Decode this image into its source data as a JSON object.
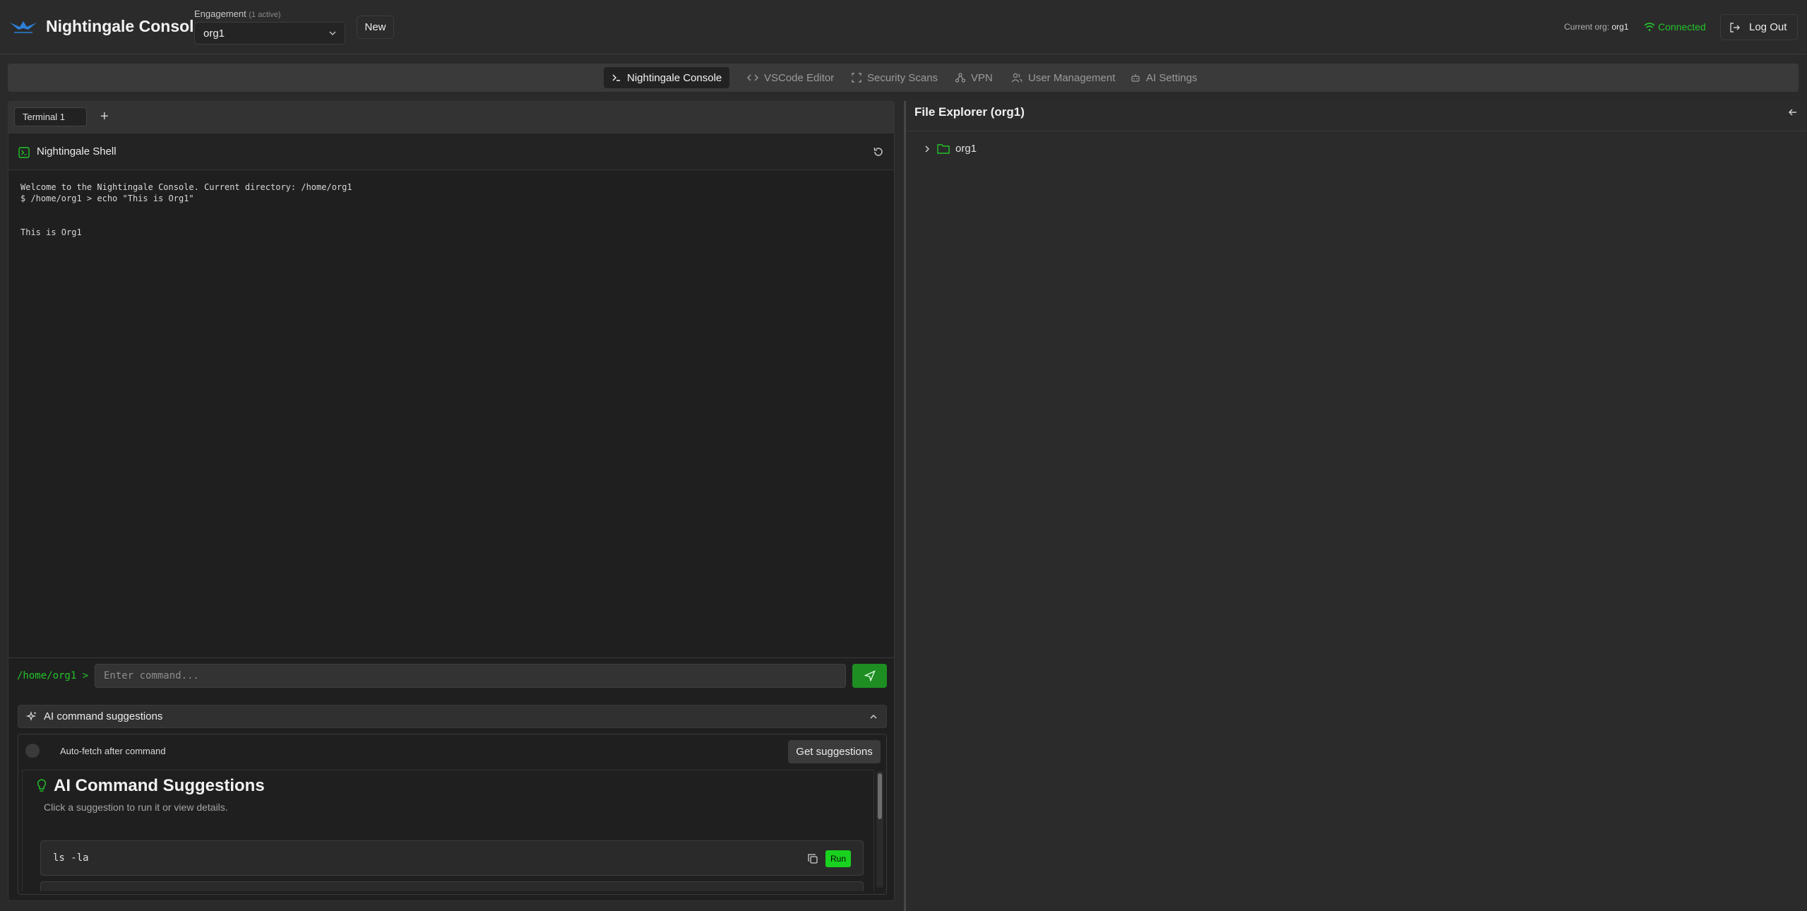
{
  "header": {
    "app_title": "Nightingale Console",
    "engagement_label": "Engagement",
    "engagement_count": "(1 active)",
    "engagement_value": "org1",
    "new_button": "New",
    "current_org_label": "Current org:",
    "current_org_value": "org1",
    "status": "Connected",
    "logout": "Log Out"
  },
  "nav": {
    "tabs": [
      {
        "label": "Nightingale Console",
        "icon": "terminal-icon",
        "active": true
      },
      {
        "label": "VSCode Editor",
        "icon": "code-icon",
        "active": false
      },
      {
        "label": "Security Scans",
        "icon": "scan-icon",
        "active": false
      },
      {
        "label": "VPN",
        "icon": "network-icon",
        "active": false
      },
      {
        "label": "User Management",
        "icon": "users-icon",
        "active": false
      },
      {
        "label": "AI Settings",
        "icon": "bot-icon",
        "active": false
      }
    ]
  },
  "terminal": {
    "tabs": [
      {
        "label": "Terminal 1"
      }
    ],
    "shell_title": "Nightingale Shell",
    "output": "Welcome to the Nightingale Console. Current directory: /home/org1\n$ /home/org1 > echo \"This is Org1\"\n\n\nThis is Org1",
    "prompt": "/home/org1 >",
    "input_placeholder": "Enter command...",
    "input_value": ""
  },
  "ai": {
    "section_title": "AI command suggestions",
    "auto_fetch_label": "Auto-fetch after command",
    "get_suggestions": "Get suggestions",
    "panel_title": "AI Command Suggestions",
    "panel_subtitle": "Click a suggestion to run it or view details.",
    "suggestions": [
      {
        "command": "ls -la",
        "run_label": "Run"
      }
    ]
  },
  "file_explorer": {
    "title": "File Explorer (org1)",
    "nodes": [
      {
        "label": "org1",
        "type": "folder",
        "expanded": false
      }
    ]
  },
  "colors": {
    "accent_green": "#22c42a",
    "run_button": "#19d11f",
    "send_button": "#1e8e22",
    "background": "#2a2a2a"
  }
}
